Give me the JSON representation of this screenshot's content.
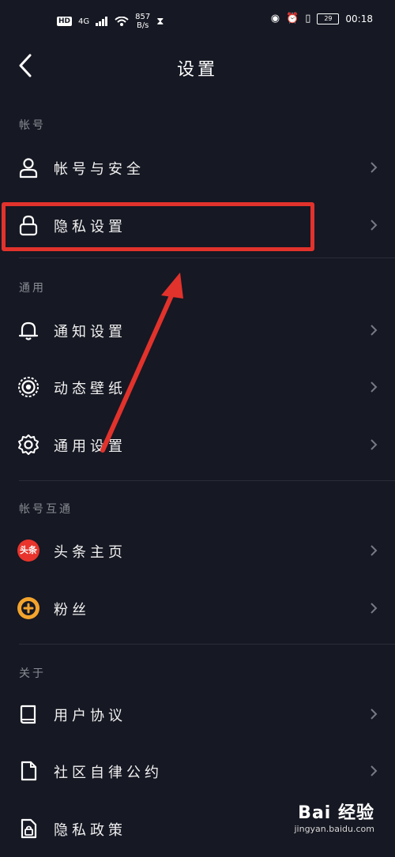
{
  "status_bar": {
    "hd": "HD",
    "signal": "4G",
    "speed": "857",
    "speed_unit": "B/s",
    "battery": "29",
    "time": "00:18"
  },
  "header": {
    "title": "设置"
  },
  "sections": [
    {
      "label": "帐号",
      "items": [
        {
          "label": "帐号与安全"
        },
        {
          "label": "隐私设置"
        }
      ]
    },
    {
      "label": "通用",
      "items": [
        {
          "label": "通知设置"
        },
        {
          "label": "动态壁纸"
        },
        {
          "label": "通用设置"
        }
      ]
    },
    {
      "label": "帐号互通",
      "items": [
        {
          "label": "头条主页",
          "icon_text": "头条"
        },
        {
          "label": "粉丝"
        }
      ]
    },
    {
      "label": "关于",
      "items": [
        {
          "label": "用户协议"
        },
        {
          "label": "社区自律公约"
        },
        {
          "label": "隐私政策"
        }
      ]
    }
  ],
  "annotation_color": "#e2322c",
  "watermark": {
    "logo": "Bai 经验",
    "url": "jingyan.baidu.com"
  }
}
